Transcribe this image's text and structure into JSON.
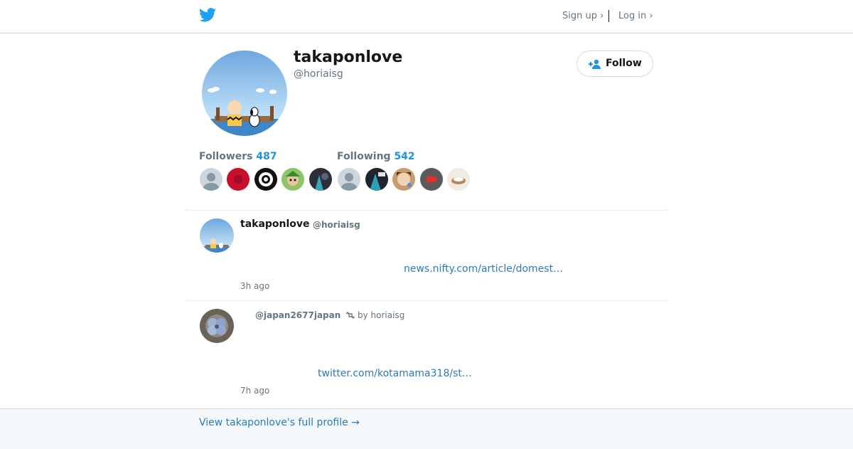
{
  "header": {
    "logo_icon": "twitter-bird-icon",
    "signup_label": "Sign up ›",
    "login_label": "Log in ›"
  },
  "profile": {
    "name": "takaponlove",
    "handle": "@horiaisg",
    "follow_label": "Follow",
    "follow_icon": "add-person-icon"
  },
  "stats": {
    "followers_label": "Followers",
    "followers_count": "487",
    "following_label": "Following",
    "following_count": "542"
  },
  "tweets": [
    {
      "name": "takaponlove",
      "handle": "@horiaisg",
      "link": "news.nifty.com/article/domest…",
      "time": "3h ago"
    },
    {
      "rt_handle": "@japan2677japan",
      "rt_icon": "retweet-icon",
      "rt_by": "by horiaisg",
      "link": "twitter.com/kotamama318/st…",
      "time": "7h ago"
    }
  ],
  "footer": {
    "link": "View takaponlove's full profile →"
  },
  "colors": {
    "accent": "#1b95e0",
    "link": "#2b7bb9",
    "muted": "#66757f"
  }
}
